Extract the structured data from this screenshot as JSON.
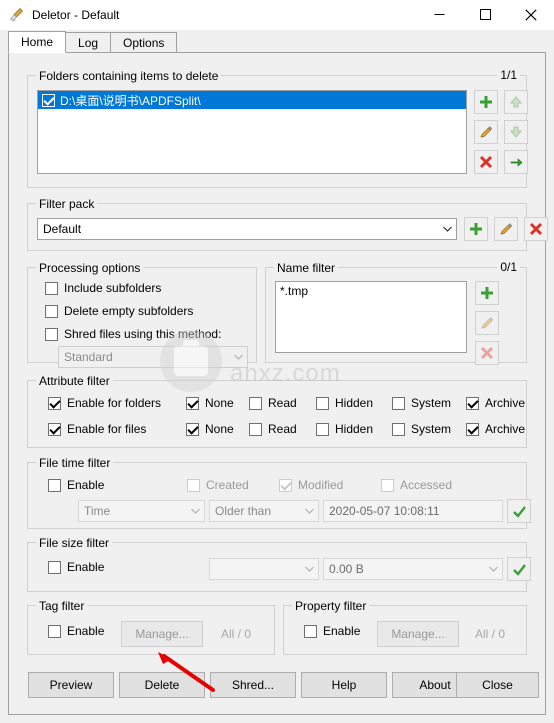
{
  "window": {
    "title": "Deletor - Default",
    "icon": "broom-icon",
    "minimize": "minimize-icon",
    "maximize": "maximize-icon",
    "close": "close-icon"
  },
  "tabs": [
    {
      "label": "Home",
      "active": true
    },
    {
      "label": "Log",
      "active": false
    },
    {
      "label": "Options",
      "active": false
    }
  ],
  "folders_group": {
    "legend": "Folders containing items to delete",
    "counter": "1/1",
    "items": [
      {
        "checked": true,
        "path": "D:\\桌面\\说明书\\APDFSplit\\"
      }
    ],
    "buttons": [
      {
        "name": "add-folder-button",
        "icon": "plus-green-icon"
      },
      {
        "name": "move-up-button",
        "icon": "arrow-up-icon"
      },
      {
        "name": "edit-folder-button",
        "icon": "pencil-icon"
      },
      {
        "name": "move-down-button",
        "icon": "arrow-down-icon"
      },
      {
        "name": "delete-folder-button",
        "icon": "cross-red-icon"
      },
      {
        "name": "open-folder-button",
        "icon": "arrow-right-green-icon"
      }
    ]
  },
  "filter_pack": {
    "legend": "Filter pack",
    "value": "Default",
    "buttons": [
      {
        "name": "add-filter-pack-button",
        "icon": "plus-green-icon"
      },
      {
        "name": "edit-filter-pack-button",
        "icon": "pencil-icon"
      },
      {
        "name": "delete-filter-pack-button",
        "icon": "cross-red-icon"
      }
    ]
  },
  "processing_options": {
    "legend": "Processing options",
    "include_subfolders": {
      "label": "Include subfolders",
      "checked": false
    },
    "delete_empty_subfolders": {
      "label": "Delete empty subfolders",
      "checked": false
    },
    "shred_files": {
      "label": "Shred files using this method:",
      "checked": false
    },
    "shred_method": {
      "value": "Standard",
      "disabled": true
    }
  },
  "name_filter": {
    "legend": "Name filter",
    "counter": "0/1",
    "items": [
      "*.tmp"
    ],
    "buttons": [
      {
        "name": "add-name-filter-button",
        "icon": "plus-green-icon"
      },
      {
        "name": "edit-name-filter-button",
        "icon": "pencil-icon"
      },
      {
        "name": "delete-name-filter-button",
        "icon": "cross-red-icon"
      }
    ]
  },
  "attribute_filter": {
    "legend": "Attribute filter",
    "rows": [
      {
        "enable": {
          "label": "Enable for folders",
          "checked": true
        },
        "flags": [
          {
            "label": "None",
            "checked": true
          },
          {
            "label": "Read",
            "checked": false
          },
          {
            "label": "Hidden",
            "checked": false
          },
          {
            "label": "System",
            "checked": false
          },
          {
            "label": "Archive",
            "checked": true
          }
        ]
      },
      {
        "enable": {
          "label": "Enable for files",
          "checked": true
        },
        "flags": [
          {
            "label": "None",
            "checked": true
          },
          {
            "label": "Read",
            "checked": false
          },
          {
            "label": "Hidden",
            "checked": false
          },
          {
            "label": "System",
            "checked": false
          },
          {
            "label": "Archive",
            "checked": true
          }
        ]
      }
    ]
  },
  "file_time_filter": {
    "legend": "File time filter",
    "enable": {
      "label": "Enable",
      "checked": false
    },
    "created": {
      "label": "Created",
      "checked": false
    },
    "modified": {
      "label": "Modified",
      "checked": true
    },
    "accessed": {
      "label": "Accessed",
      "checked": false
    },
    "kind": "Time",
    "comparison": "Older than",
    "value": "2020-05-07 10:08:11",
    "apply_button": "check-green-icon"
  },
  "file_size_filter": {
    "legend": "File size filter",
    "enable": {
      "label": "Enable",
      "checked": false
    },
    "comparison": "",
    "value": "0.00 B",
    "apply_button": "check-green-icon"
  },
  "tag_filter": {
    "legend": "Tag filter",
    "enable": {
      "label": "Enable",
      "checked": false
    },
    "manage": "Manage...",
    "counter": "All / 0"
  },
  "property_filter": {
    "legend": "Property filter",
    "enable": {
      "label": "Enable",
      "checked": false
    },
    "manage": "Manage...",
    "counter": "All / 0"
  },
  "footer_buttons": [
    {
      "name": "preview-button",
      "label": "Preview"
    },
    {
      "name": "delete-button",
      "label": "Delete"
    },
    {
      "name": "shred-button",
      "label": "Shred..."
    },
    {
      "name": "help-button",
      "label": "Help"
    },
    {
      "name": "about-button",
      "label": "About"
    },
    {
      "name": "close-button",
      "label": "Close"
    }
  ],
  "watermark": {
    "text": "anxz.com"
  },
  "colors": {
    "selection": "#0078d7",
    "green": "#3aa033",
    "red": "#d9332b",
    "annotation_red": "#e60000"
  }
}
